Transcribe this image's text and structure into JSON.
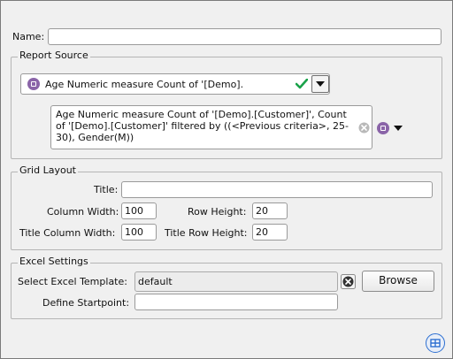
{
  "form": {
    "name_label": "Name:",
    "name_value": ""
  },
  "report_source": {
    "legend": "Report Source",
    "selected": "Age Numeric measure Count of '[Demo].",
    "description": "Age Numeric measure Count of '[Demo].[Customer]', Count of '[Demo].[Customer]' filtered by ((<Previous criteria>, 25-30), Gender(M))",
    "icons": {
      "measure": "measure-icon",
      "valid": "checkmark-icon",
      "clear": "clear-icon",
      "dropdown": "chevron-down-icon"
    },
    "colors": {
      "accent": "#8a64a8",
      "valid": "#1aa24a"
    }
  },
  "grid_layout": {
    "legend": "Grid Layout",
    "title_label": "Title:",
    "title_value": "",
    "column_width_label": "Column Width:",
    "column_width_value": "100",
    "row_height_label": "Row Height:",
    "row_height_value": "20",
    "title_column_width_label": "Title Column Width:",
    "title_column_width_value": "100",
    "title_row_height_label": "Title Row Height:",
    "title_row_height_value": "20"
  },
  "excel_settings": {
    "legend": "Excel Settings",
    "template_label": "Select Excel Template:",
    "template_value": "default",
    "browse_label": "Browse",
    "startpoint_label": "Define Startpoint:",
    "startpoint_value": ""
  },
  "footer": {
    "icon": "grid-icon",
    "accent": "#2d6fd1"
  }
}
